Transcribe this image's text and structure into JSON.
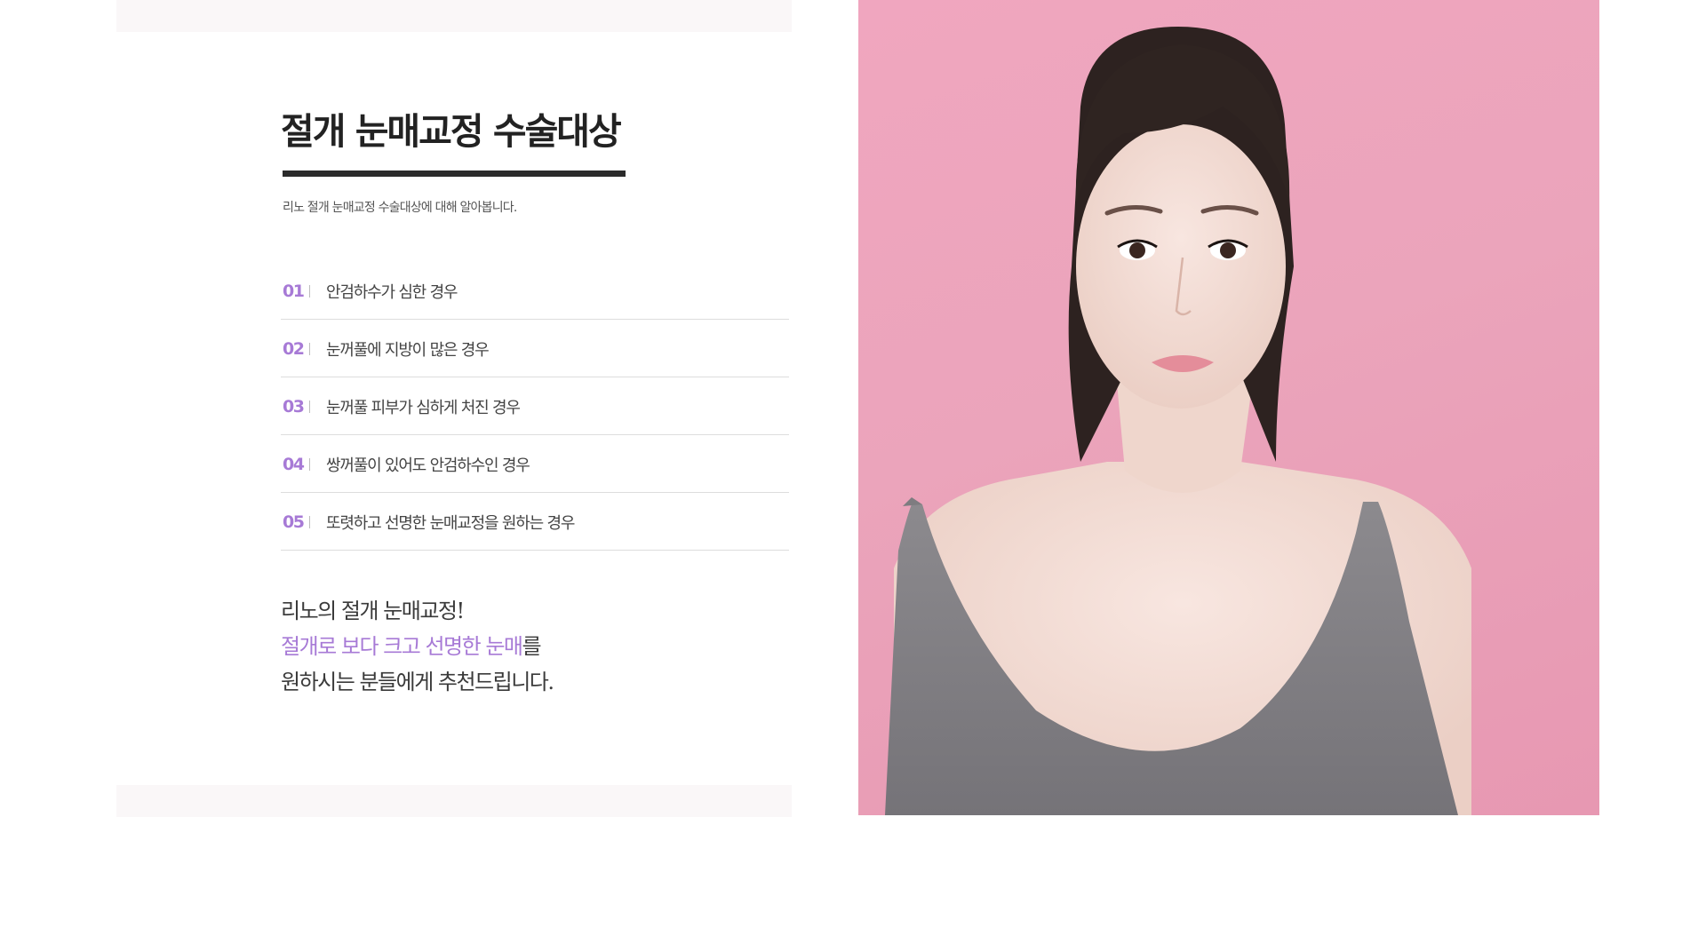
{
  "section": {
    "title": "절개 눈매교정 수술대상",
    "subtitle": "리노 절개 눈매교정 수술대상에 대해 알아봅니다."
  },
  "items": [
    {
      "num": "01",
      "text": "안검하수가 심한 경우"
    },
    {
      "num": "02",
      "text": "눈꺼풀에 지방이 많은 경우"
    },
    {
      "num": "03",
      "text": "눈꺼풀 피부가 심하게 처진 경우"
    },
    {
      "num": "04",
      "text": "쌍꺼풀이 있어도 안검하수인 경우"
    },
    {
      "num": "05",
      "text": "또렷하고 선명한 눈매교정을 원하는 경우"
    }
  ],
  "closing": {
    "line1": "리노의 절개 눈매교정!",
    "line2_accent": "절개로 보다 크고 선명한 눈매",
    "line2_rest": "를",
    "line3": "원하시는 분들에게 추천드립니다."
  },
  "colors": {
    "accent": "#a77ad6",
    "photo_background": "#eea4bc",
    "title_bar": "#2b2b2b"
  }
}
